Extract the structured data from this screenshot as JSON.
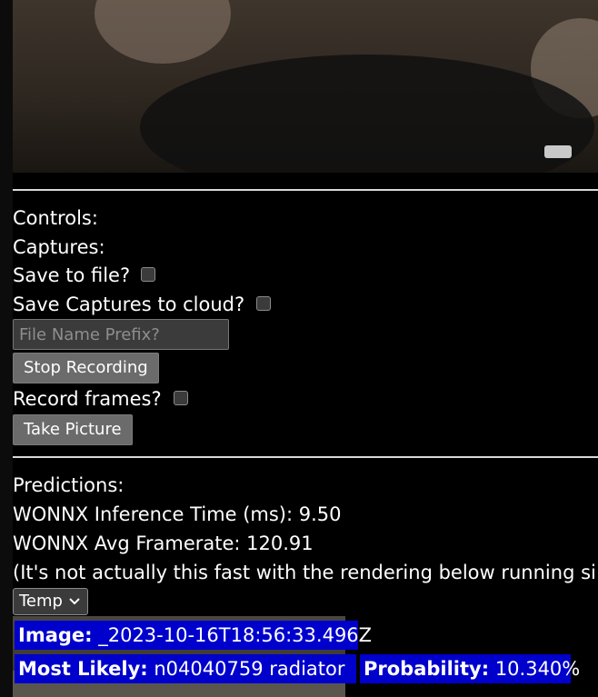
{
  "controls": {
    "heading": "Controls:",
    "captures_label": "Captures:",
    "save_to_file_label": "Save to file?",
    "save_to_cloud_label": "Save Captures to cloud?",
    "file_prefix_placeholder": "File Name Prefix?",
    "stop_recording_label": "Stop Recording",
    "record_frames_label": "Record frames?",
    "take_picture_label": "Take Picture"
  },
  "predictions": {
    "heading": "Predictions:",
    "inference_time": "WONNX Inference Time (ms): 9.50",
    "avg_framerate": "WONNX Avg Framerate: 120.91",
    "note": "(It's not actually this fast with the rendering below running si",
    "temp_option": "Temp",
    "image_label": "Image:",
    "image_value": " _2023-10-16T18:56:33.496Z",
    "most_likely_label": "Most Likely:",
    "most_likely_value": " n04040759 radiator",
    "probability_label": "Probability:",
    "probability_value": " 10.340%"
  },
  "icons": {
    "dropdown": "chevron-down-icon"
  },
  "colors": {
    "background": "#000000",
    "overlay_blue": "#0000cc",
    "button_gray": "#6b6b6b"
  }
}
